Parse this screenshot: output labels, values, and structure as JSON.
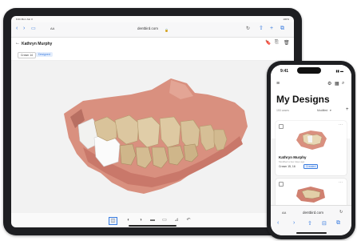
{
  "tablet": {
    "status_left": "9:41 Mon Jun 3",
    "status_right": "100%",
    "browser": {
      "aa": "AA",
      "url": "dentbird.com"
    },
    "app": {
      "patient_name": "Kathryn Murphy",
      "chip_tooth": "Crown 14",
      "chip_status": "Designed"
    },
    "colors": {
      "accent": "#3b7de0",
      "bookmark": "#e0392b",
      "viewer_bg": "#f2f2f2"
    }
  },
  "phone": {
    "time": "9:41",
    "title": "My Designs",
    "count": "153 cases",
    "sort": "Modified",
    "card1": {
      "name": "Kathryn Murphy",
      "subtitle": "Modified a few days ago",
      "tooth": "Crown 15, 16",
      "status": "Created"
    },
    "browser": {
      "aa": "AA",
      "url": "dentbird.com"
    }
  },
  "icons": [
    "back-arrow-icon",
    "sidebar-icon",
    "share-icon",
    "plus-icon",
    "tabs-icon",
    "bookmark-icon",
    "download-icon",
    "trash-icon",
    "menu-icon",
    "settings-icon",
    "calendar-icon",
    "search-icon",
    "more-icon",
    "reload-icon",
    "lock-icon"
  ]
}
